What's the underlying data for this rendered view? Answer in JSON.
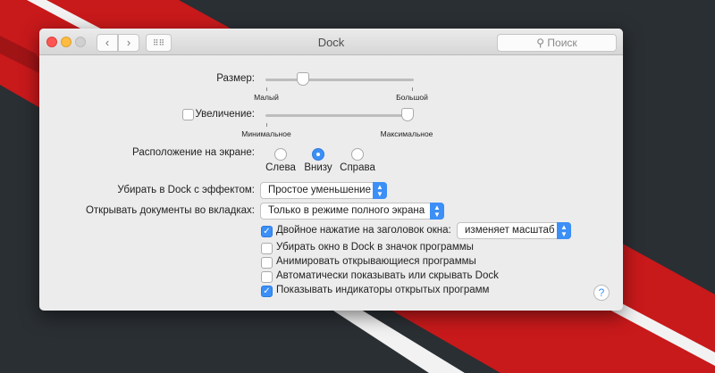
{
  "window": {
    "title": "Dock",
    "search_placeholder": "Поиск"
  },
  "size": {
    "label": "Размер:",
    "min": "Малый",
    "max": "Большой",
    "value": 0.25
  },
  "magnification": {
    "label": "Увеличение:",
    "checked": false,
    "min": "Минимальное",
    "max": "Максимальное",
    "value": 0.97
  },
  "position": {
    "label": "Расположение на экране:",
    "options": [
      "Слева",
      "Внизу",
      "Справа"
    ],
    "selected": "Внизу"
  },
  "minimize_effect": {
    "label": "Убирать в Dock с эффектом:",
    "value": "Простое уменьшение"
  },
  "tabs": {
    "label": "Открывать документы во вкладках:",
    "value": "Только в режиме полного экрана"
  },
  "double_click": {
    "label": "Двойное нажатие на заголовок окна:",
    "checked": true,
    "value": "изменяет масштаб"
  },
  "checkboxes": [
    {
      "label": "Убирать окно в Dock в значок программы",
      "checked": false
    },
    {
      "label": "Анимировать открывающиеся программы",
      "checked": false
    },
    {
      "label": "Автоматически показывать или скрывать Dock",
      "checked": false
    },
    {
      "label": "Показывать индикаторы открытых программ",
      "checked": true
    }
  ],
  "help": "?",
  "colors": {
    "accent": "#3b8ff6",
    "stripe": "#c8191b"
  }
}
